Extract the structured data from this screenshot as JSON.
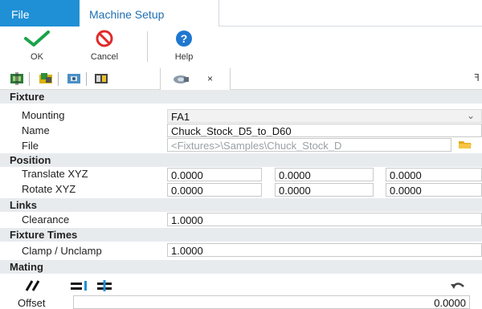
{
  "ribbon": {
    "tabs": {
      "file": "File",
      "machine_setup": "Machine Setup"
    },
    "buttons": {
      "ok": "OK",
      "cancel": "Cancel",
      "help": "Help"
    }
  },
  "toolstrip": {
    "close_glyph": "×",
    "pin_glyph": "ꟻ"
  },
  "fixture": {
    "section": "Fixture",
    "mounting_label": "Mounting",
    "mounting_value": "FA1",
    "name_label": "Name",
    "name_value": "Chuck_Stock_D5_to_D60",
    "file_label": "File",
    "file_value": "<Fixtures>\\Samples\\Chuck_Stock_D"
  },
  "position": {
    "section": "Position",
    "translate_label": "Translate XYZ",
    "translate": [
      "0.0000",
      "0.0000",
      "0.0000"
    ],
    "rotate_label": "Rotate XYZ",
    "rotate": [
      "0.0000",
      "0.0000",
      "0.0000"
    ]
  },
  "links": {
    "section": "Links",
    "clearance_label": "Clearance",
    "clearance_value": "1.0000"
  },
  "fixture_times": {
    "section": "Fixture Times",
    "clamp_label": "Clamp / Unclamp",
    "clamp_value": "1.0000"
  },
  "mating": {
    "section": "Mating",
    "offset_label": "Offset",
    "offset_value": "0.0000"
  },
  "colors": {
    "accent": "#1f8fd6",
    "ok_green": "#1aa34a",
    "cancel_red": "#e02b2b",
    "section_bg": "#e8ebee"
  },
  "icons": [
    "check-icon",
    "cancel-icon",
    "help-icon",
    "folder-icon",
    "parallel-icon",
    "align-icon",
    "center-icon",
    "undo-icon"
  ]
}
